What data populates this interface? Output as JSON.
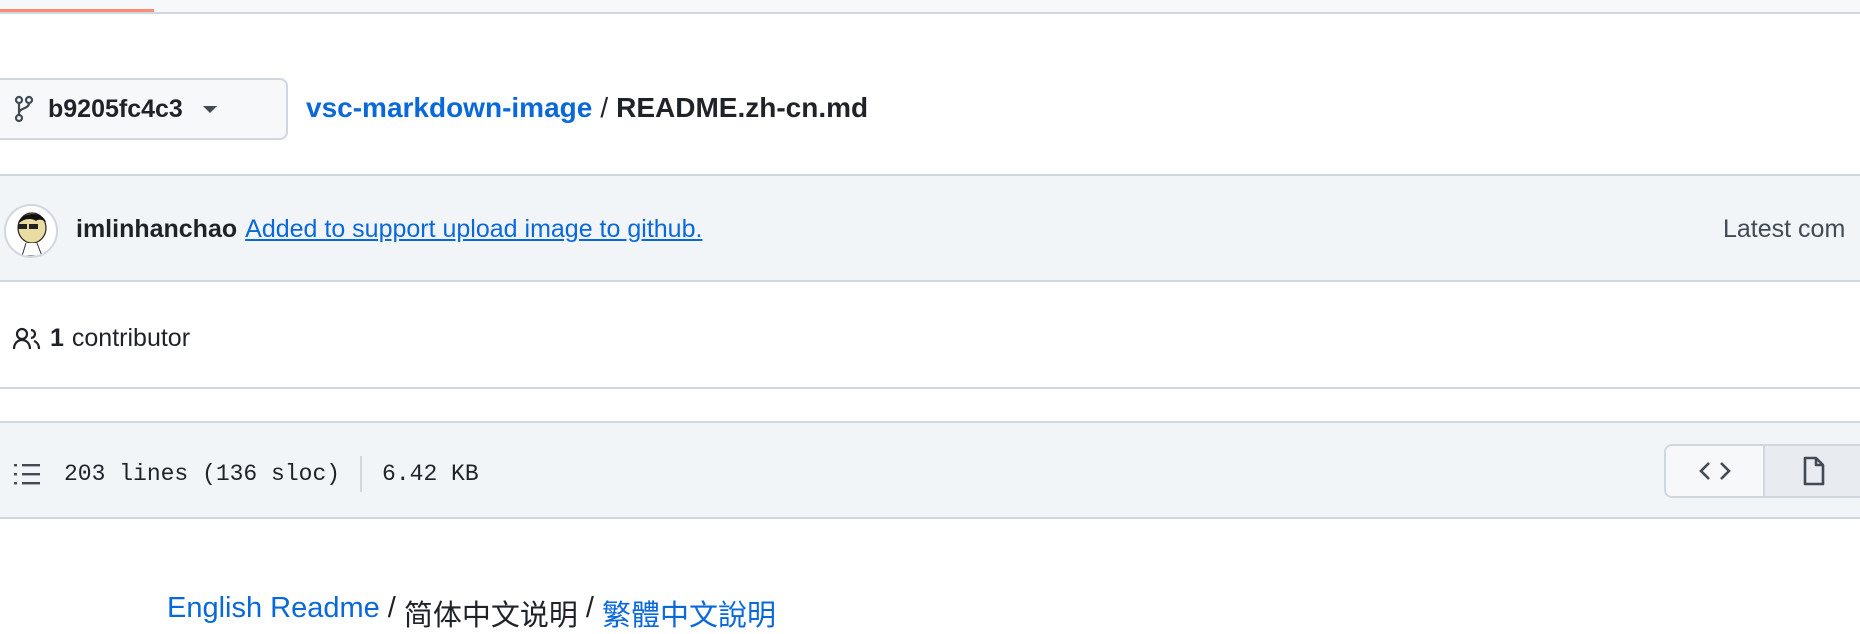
{
  "branch": {
    "name": "b9205fc4c3"
  },
  "breadcrumb": {
    "repo": "vsc-markdown-image",
    "separator": "/",
    "file": "README.zh-cn.md"
  },
  "commit": {
    "author": "imlinhanchao",
    "message": "Added to support upload image to github.",
    "latest_label": "Latest com"
  },
  "contributors": {
    "count": "1",
    "label": "contributor"
  },
  "file_info": {
    "lines": "203 lines (136 sloc)",
    "size": "6.42 KB"
  },
  "readme_links": {
    "english": "English Readme",
    "sep": "/",
    "simplified": "简体中文说明",
    "traditional": "繁體中文說明"
  },
  "colors": {
    "accent": "#0969da",
    "progress": "#fd8c73",
    "border": "#d0d7de",
    "panel": "#f2f5f8"
  }
}
